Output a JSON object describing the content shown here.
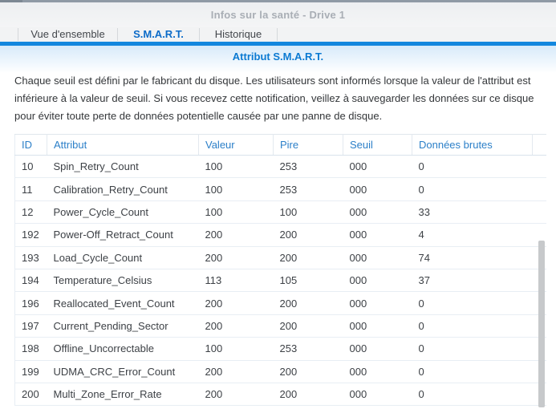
{
  "window": {
    "title": "Infos sur la santé - Drive 1"
  },
  "tabs": [
    {
      "label": "Vue d'ensemble",
      "active": false
    },
    {
      "label": "S.M.A.R.T.",
      "active": true
    },
    {
      "label": "Historique",
      "active": false
    }
  ],
  "section": {
    "title": "Attribut S.M.A.R.T.",
    "description": "Chaque seuil est défini par le fabricant du disque. Les utilisateurs sont informés lorsque la valeur de l'attribut est inférieure à la valeur de seuil. Si vous recevez cette notification, veillez à sauvegarder les données sur ce disque pour éviter toute perte de données potentielle causée par une panne de disque."
  },
  "table": {
    "columns": [
      "ID",
      "Attribut",
      "Valeur",
      "Pire",
      "Seuil",
      "Données brutes"
    ],
    "rows": [
      [
        "10",
        "Spin_Retry_Count",
        "100",
        "253",
        "000",
        "0"
      ],
      [
        "11",
        "Calibration_Retry_Count",
        "100",
        "253",
        "000",
        "0"
      ],
      [
        "12",
        "Power_Cycle_Count",
        "100",
        "100",
        "000",
        "33"
      ],
      [
        "192",
        "Power-Off_Retract_Count",
        "200",
        "200",
        "000",
        "4"
      ],
      [
        "193",
        "Load_Cycle_Count",
        "200",
        "200",
        "000",
        "74"
      ],
      [
        "194",
        "Temperature_Celsius",
        "113",
        "105",
        "000",
        "37"
      ],
      [
        "196",
        "Reallocated_Event_Count",
        "200",
        "200",
        "000",
        "0"
      ],
      [
        "197",
        "Current_Pending_Sector",
        "200",
        "200",
        "000",
        "0"
      ],
      [
        "198",
        "Offline_Uncorrectable",
        "100",
        "253",
        "000",
        "0"
      ],
      [
        "199",
        "UDMA_CRC_Error_Count",
        "200",
        "200",
        "000",
        "0"
      ],
      [
        "200",
        "Multi_Zone_Error_Rate",
        "200",
        "200",
        "000",
        "0"
      ]
    ]
  },
  "colors": {
    "accent_bar": "#1387de",
    "active_tab": "#0c6bc8",
    "section_title": "#0b7ad2",
    "header_text": "#2b7fc8",
    "title_text": "#a9aeb5",
    "scrollbar_thumb": "#c7c9cb"
  }
}
